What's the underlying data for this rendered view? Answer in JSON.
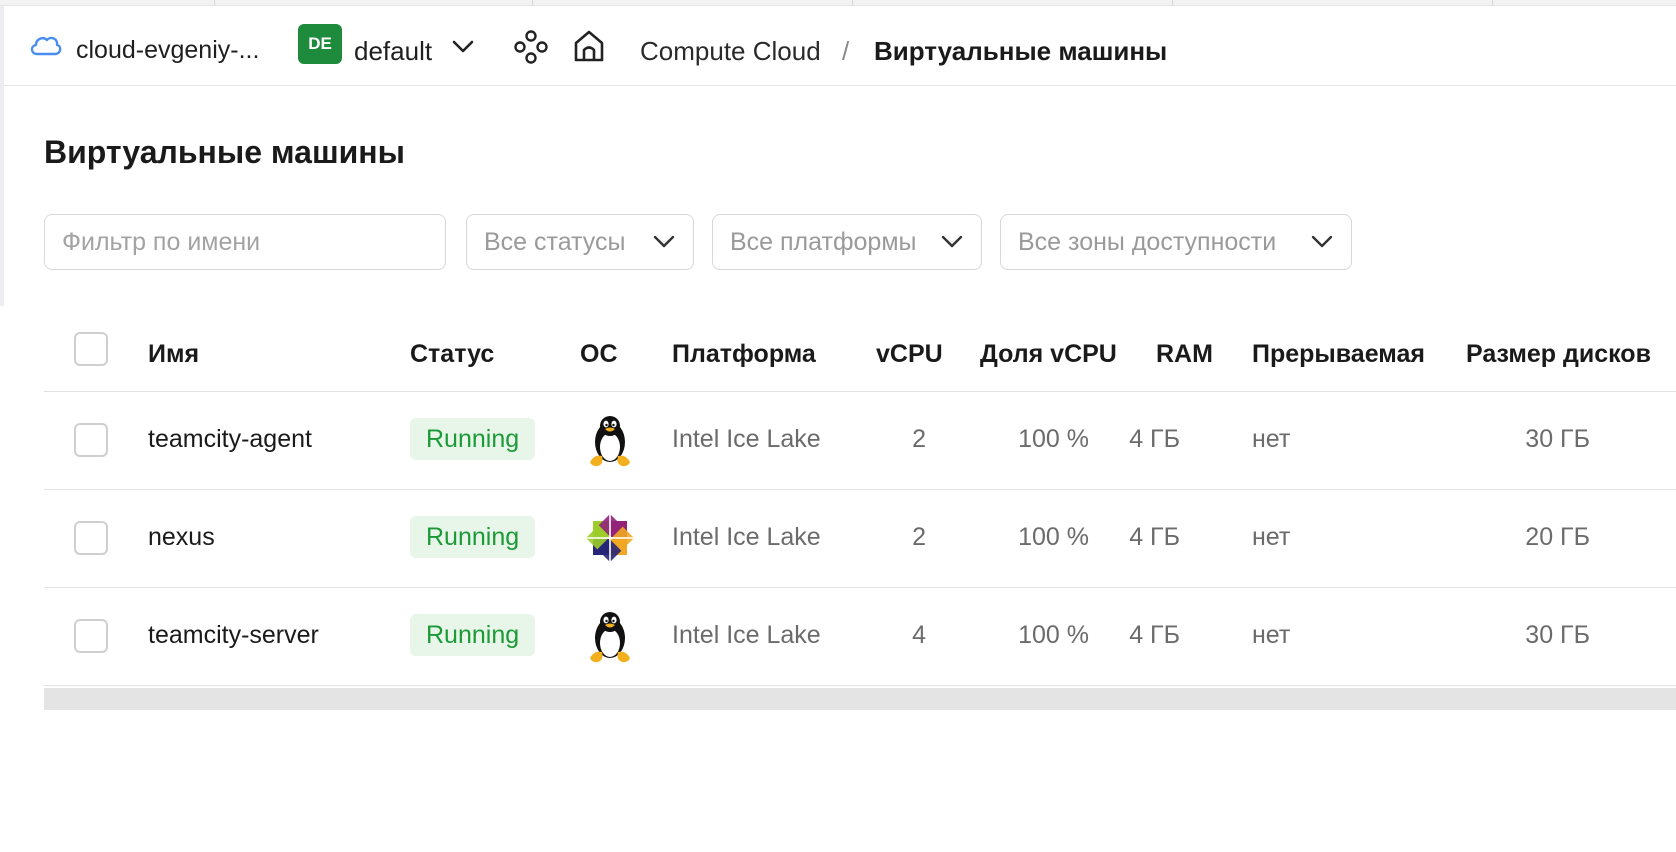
{
  "topbar": {
    "cloud_name": "cloud-evgeniy-...",
    "folder_badge": "DE",
    "folder_name": "default",
    "breadcrumb_service": "Compute Cloud",
    "breadcrumb_separator": "/",
    "breadcrumb_current": "Виртуальные машины"
  },
  "page": {
    "title": "Виртуальные машины"
  },
  "filters": {
    "name_placeholder": "Фильтр по имени",
    "status": "Все статусы",
    "platform": "Все платформы",
    "zone": "Все зоны доступности"
  },
  "table": {
    "columns": {
      "name": "Имя",
      "status": "Статус",
      "os": "ОС",
      "platform": "Платформа",
      "vcpu": "vCPU",
      "vcpu_share": "Доля vCPU",
      "ram": "RAM",
      "preemptible": "Прерываемая",
      "disk_size": "Размер дисков"
    },
    "rows": [
      {
        "name": "teamcity-agent",
        "status": "Running",
        "os_icon": "linux-tux-icon",
        "platform": "Intel Ice Lake",
        "vcpu": "2",
        "vcpu_share": "100 %",
        "ram": "4 ГБ",
        "preemptible": "нет",
        "disk_size": "30 ГБ"
      },
      {
        "name": "nexus",
        "status": "Running",
        "os_icon": "centos-icon",
        "platform": "Intel Ice Lake",
        "vcpu": "2",
        "vcpu_share": "100 %",
        "ram": "4 ГБ",
        "preemptible": "нет",
        "disk_size": "20 ГБ"
      },
      {
        "name": "teamcity-server",
        "status": "Running",
        "os_icon": "linux-tux-icon",
        "platform": "Intel Ice Lake",
        "vcpu": "4",
        "vcpu_share": "100 %",
        "ram": "4 ГБ",
        "preemptible": "нет",
        "disk_size": "30 ГБ"
      }
    ]
  },
  "colors": {
    "folder_badge": "#1d8a3c",
    "status_running_text": "#1c9a37",
    "status_running_bg": "#e8f6ea",
    "cloud_icon": "#4a8df0"
  }
}
